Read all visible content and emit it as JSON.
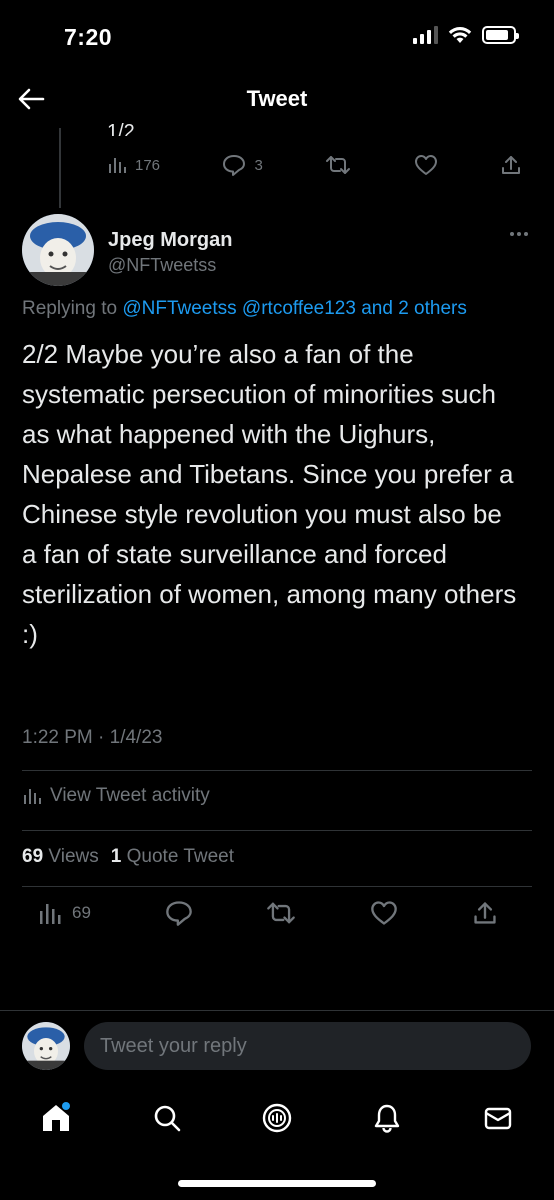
{
  "status_bar": {
    "time": "7:20",
    "battery_level": 0.85
  },
  "header": {
    "title": "Tweet"
  },
  "previous_tweet": {
    "text_fragment": "1/2",
    "views": "176",
    "replies": "3"
  },
  "tweet": {
    "author_name": "Jpeg Morgan",
    "author_handle": "@NFTweetss",
    "replying_prefix": "Replying to ",
    "replying_links": "@NFTweetss @rtcoffee123 and 2 others",
    "body": "2/2 Maybe you’re also a fan of the systematic persecution of minorities such as what happened with the Uighurs, Nepalese and Tibetans. Since you prefer a Chinese style revolution you must also be a fan of state surveillance and forced sterilization of women, among many others :)",
    "timestamp": "1:22 PM · 1/4/23",
    "view_activity_label": "View Tweet activity",
    "views_count": "69",
    "views_label": "Views",
    "quote_count": "1",
    "quote_label": "Quote Tweet",
    "action_views": "69"
  },
  "reply_bar": {
    "placeholder": "Tweet your reply"
  },
  "colors": {
    "accent": "#1d9bf0",
    "background": "#000000",
    "secondary_text": "#71767b"
  }
}
